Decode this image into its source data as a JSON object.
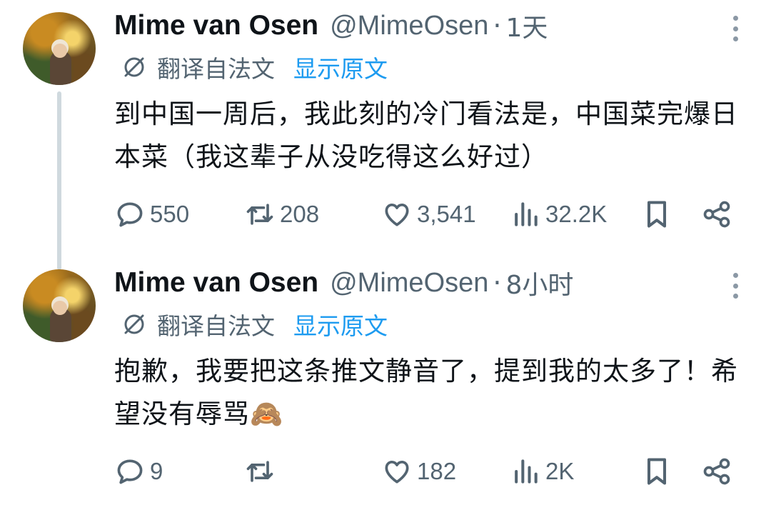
{
  "tweets": [
    {
      "name": "Mime van Osen",
      "handle": "@MimeOsen",
      "separator": "·",
      "time": "1天",
      "translate_label": "翻译自法文",
      "translate_link": "显示原文",
      "text": "到中国一周后，我此刻的冷门看法是，中国菜完爆日本菜（我这辈子从没吃得这么好过）",
      "replies": "550",
      "retweets": "208",
      "likes": "3,541",
      "views": "32.2K"
    },
    {
      "name": "Mime van Osen",
      "handle": "@MimeOsen",
      "separator": "·",
      "time": "8小时",
      "translate_label": "翻译自法文",
      "translate_link": "显示原文",
      "text": "抱歉，我要把这条推文静音了，提到我的太多了！希望没有辱骂🙈",
      "replies": "9",
      "retweets": "",
      "likes": "182",
      "views": "2K"
    }
  ],
  "icons": {
    "translate": "translate-icon",
    "reply": "reply-icon",
    "retweet": "retweet-icon",
    "like": "heart-icon",
    "views": "views-icon",
    "bookmark": "bookmark-icon",
    "share": "share-icon",
    "more": "more-icon"
  },
  "colors": {
    "text": "#0f1419",
    "secondary": "#536471",
    "link": "#1d9bf0",
    "thread_line": "#cfd9de"
  }
}
